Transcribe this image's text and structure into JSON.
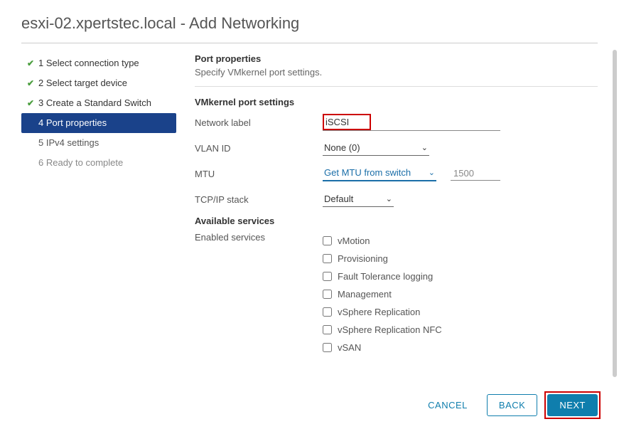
{
  "title": "esxi-02.xpertstec.local - Add Networking",
  "steps": [
    {
      "label": "1 Select connection type",
      "state": "completed"
    },
    {
      "label": "2 Select target device",
      "state": "completed"
    },
    {
      "label": "3 Create a Standard Switch",
      "state": "completed"
    },
    {
      "label": "4 Port properties",
      "state": "active"
    },
    {
      "label": "5 IPv4 settings",
      "state": "normal"
    },
    {
      "label": "6 Ready to complete",
      "state": "dim"
    }
  ],
  "content": {
    "heading": "Port properties",
    "subheading": "Specify VMkernel port settings.",
    "vmk": {
      "heading": "VMkernel port settings",
      "network_label_label": "Network label",
      "network_label_value": "iSCSI",
      "vlan_label": "VLAN ID",
      "vlan_value": "None (0)",
      "mtu_label": "MTU",
      "mtu_select": "Get MTU from switch",
      "mtu_value": "1500",
      "tcpip_label": "TCP/IP stack",
      "tcpip_value": "Default"
    },
    "services": {
      "heading": "Available services",
      "enabled_label": "Enabled services",
      "items": [
        "vMotion",
        "Provisioning",
        "Fault Tolerance logging",
        "Management",
        "vSphere Replication",
        "vSphere Replication NFC",
        "vSAN"
      ]
    }
  },
  "footer": {
    "cancel": "CANCEL",
    "back": "BACK",
    "next": "NEXT"
  }
}
